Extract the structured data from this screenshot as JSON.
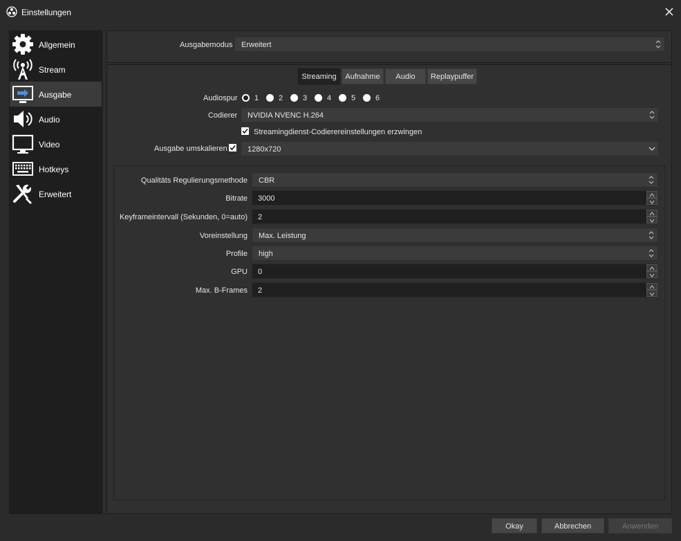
{
  "window": {
    "title": "Einstellungen",
    "icon": "obs-logo-icon",
    "close_icon": "close-icon"
  },
  "sidebar": {
    "items": [
      {
        "label": "Allgemein",
        "icon": "gear-icon"
      },
      {
        "label": "Stream",
        "icon": "antenna-icon"
      },
      {
        "label": "Ausgabe",
        "icon": "output-monitor-icon",
        "active": true
      },
      {
        "label": "Audio",
        "icon": "speaker-icon"
      },
      {
        "label": "Video",
        "icon": "monitor-icon"
      },
      {
        "label": "Hotkeys",
        "icon": "keyboard-icon"
      },
      {
        "label": "Erweitert",
        "icon": "wrench-screwdriver-icon"
      }
    ]
  },
  "output_mode": {
    "label": "Ausgabemodus",
    "value": "Erweitert"
  },
  "tabs": [
    {
      "label": "Streaming",
      "active": true
    },
    {
      "label": "Aufnahme"
    },
    {
      "label": "Audio"
    },
    {
      "label": "Replaypuffer"
    }
  ],
  "streaming": {
    "audio_track": {
      "label": "Audiospur",
      "options": [
        "1",
        "2",
        "3",
        "4",
        "5",
        "6"
      ],
      "selected": "1"
    },
    "encoder": {
      "label": "Codierer",
      "value": "NVIDIA NVENC H.264"
    },
    "enforce_checkbox": {
      "label": "Streamingdienst-Codierereinstellungen erzwingen",
      "checked": true
    },
    "rescale": {
      "label": "Ausgabe umskalieren",
      "checked": true,
      "value": "1280x720"
    }
  },
  "encoder_settings": {
    "rate_control": {
      "label": "Qualitäts Regulierungsmethode",
      "value": "CBR"
    },
    "bitrate": {
      "label": "Bitrate",
      "value": "3000"
    },
    "keyframe": {
      "label": "Keyframeintervall (Sekunden, 0=auto)",
      "value": "2"
    },
    "preset": {
      "label": "Voreinstellung",
      "value": "Max. Leistung"
    },
    "profile": {
      "label": "Profile",
      "value": "high"
    },
    "gpu": {
      "label": "GPU",
      "value": "0"
    },
    "bframes": {
      "label": "Max. B-Frames",
      "value": "2"
    }
  },
  "buttons": {
    "ok": "Okay",
    "cancel": "Abbrechen",
    "apply": "Anwenden"
  }
}
